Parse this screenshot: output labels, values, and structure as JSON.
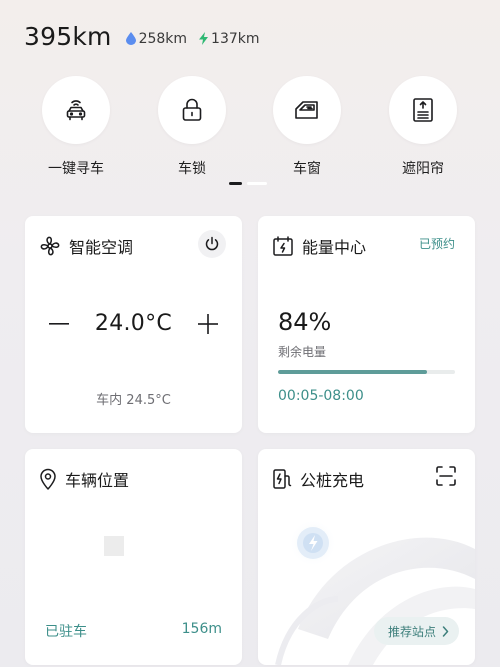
{
  "header": {
    "range": "395km",
    "sub_ranges": [
      {
        "icon": "droplet-icon",
        "value": "258km",
        "color": "#5b8def"
      },
      {
        "icon": "lightning-icon",
        "value": "137km",
        "color": "#2eb872"
      }
    ]
  },
  "quick_controls": [
    {
      "label": "一键寻车",
      "icon": "car-signal-icon"
    },
    {
      "label": "车锁",
      "icon": "lock-icon"
    },
    {
      "label": "车窗",
      "icon": "car-window-icon"
    },
    {
      "label": "遮阳帘",
      "icon": "sunshade-icon"
    }
  ],
  "pager": {
    "count": 2,
    "active": 0
  },
  "climate": {
    "title": "智能空调",
    "set_temp": "24.0°C",
    "inside_temp": "车内 24.5°C",
    "minus_icon": "minus-icon",
    "plus_icon": "plus-icon",
    "power_icon": "power-icon"
  },
  "energy": {
    "title": "能量中心",
    "status": "已预约",
    "percent": "84%",
    "percent_value": 84,
    "label": "剩余电量",
    "schedule": "00:05-08:00"
  },
  "location": {
    "title": "车辆位置",
    "status": "已驻车",
    "distance": "156m"
  },
  "charging": {
    "title": "公桩充电",
    "action": "推荐站点"
  },
  "colors": {
    "accent": "#3d8f8a",
    "progress": "#5e9c99",
    "background": "#efedf0"
  }
}
